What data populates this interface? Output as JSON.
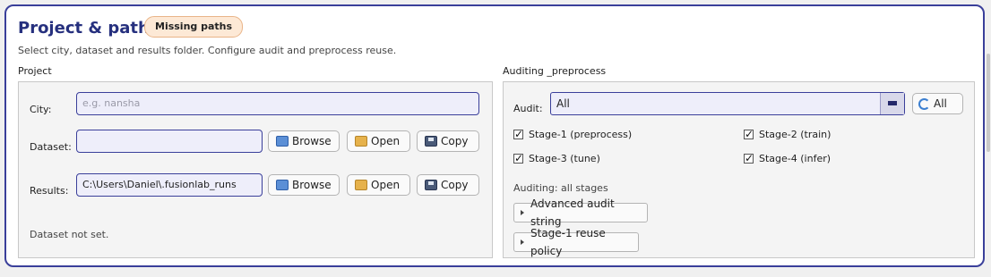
{
  "header": {
    "title": "Project & paths",
    "badge": "Missing paths",
    "subtitle": "Select city, dataset and results folder. Configure audit and preprocess reuse."
  },
  "project": {
    "group_label": "Project",
    "city": {
      "label": "City:",
      "value": "",
      "placeholder": "e.g. nansha"
    },
    "dataset": {
      "label": "Dataset:",
      "value": ""
    },
    "results": {
      "label": "Results:",
      "value": "C:\\Users\\Daniel\\.fusionlab_runs"
    },
    "buttons": {
      "browse": "Browse",
      "open": "Open",
      "copy": "Copy"
    },
    "status": "Dataset not set."
  },
  "audit": {
    "group_label": "Auditing _preprocess",
    "audit_label": "Audit:",
    "audit_value": "All",
    "all_button": "All",
    "stages": [
      {
        "label": "Stage-1 (preprocess)",
        "checked": true
      },
      {
        "label": "Stage-2 (train)",
        "checked": true
      },
      {
        "label": "Stage-3 (tune)",
        "checked": true
      },
      {
        "label": "Stage-4 (infer)",
        "checked": true
      }
    ],
    "auditing_status": "Auditing: all stages",
    "advanced_button": "Advanced audit string",
    "reuse_button": "Stage-1 reuse policy"
  },
  "colors": {
    "accent": "#3a3f9a",
    "title": "#26307e",
    "badge_bg": "#fde9d6"
  }
}
